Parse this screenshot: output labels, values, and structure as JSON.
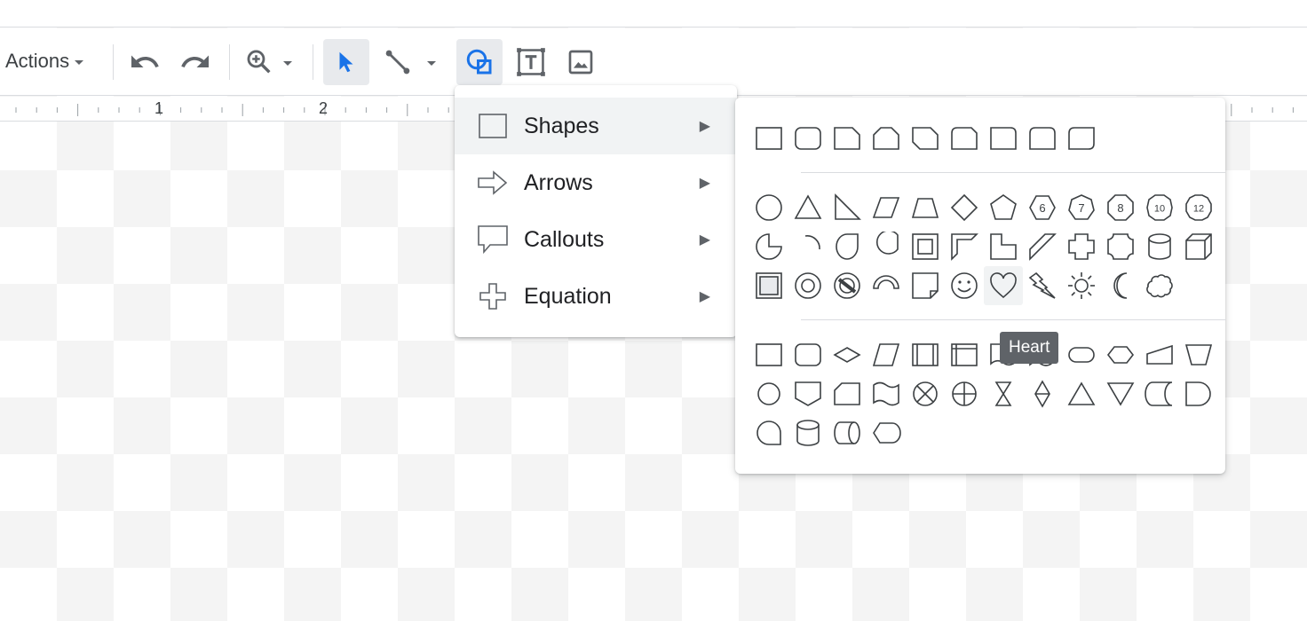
{
  "toolbar": {
    "actions_label": "Actions",
    "buttons": [
      {
        "name": "undo-icon"
      },
      {
        "name": "redo-icon"
      },
      {
        "name": "zoom-icon"
      },
      {
        "name": "select-icon"
      },
      {
        "name": "line-icon"
      },
      {
        "name": "shape-icon"
      },
      {
        "name": "text-box-icon"
      },
      {
        "name": "image-icon"
      }
    ]
  },
  "ruler": {
    "labels": [
      "1",
      "2"
    ]
  },
  "menu": {
    "items": [
      {
        "label": "Shapes",
        "icon": "rectangle-icon"
      },
      {
        "label": "Arrows",
        "icon": "arrow-icon"
      },
      {
        "label": "Callouts",
        "icon": "callout-icon"
      },
      {
        "label": "Equation",
        "icon": "plus-icon"
      }
    ],
    "submenu_glyph": "▶"
  },
  "shapes_panel": {
    "tooltip": "Heart",
    "octagon_labels": [
      "6",
      "7",
      "8",
      "10",
      "12"
    ]
  },
  "colors": {
    "accent": "#1a73e8",
    "icon": "#5f6368",
    "shape_stroke": "#3c4043"
  }
}
